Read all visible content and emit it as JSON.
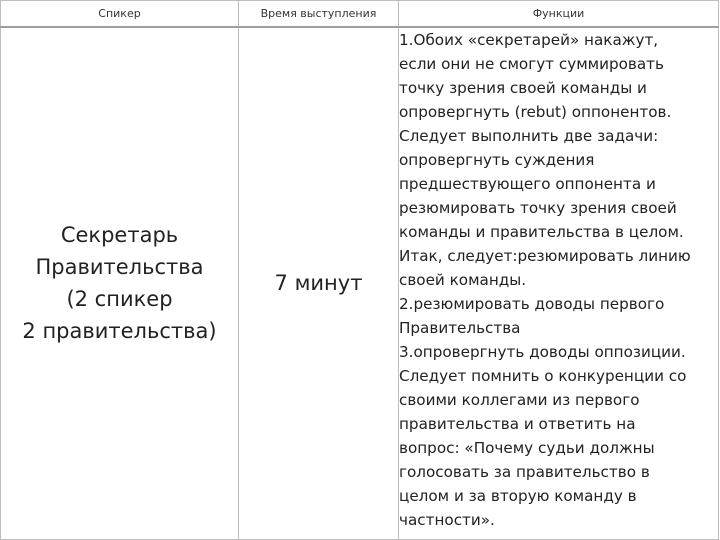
{
  "table": {
    "headers": {
      "speaker": "Спикер",
      "time": "Время выступления",
      "functions": "Функции"
    },
    "row": {
      "speaker_lines": [
        "Секретарь",
        "Правительства",
        "(2 спикер",
        "2 правительства)"
      ],
      "time": "7 минут",
      "function_lines": [
        "1.Обоих «секретарей» накажут,",
        "если они не смогут суммировать",
        "точку зрения своей команды и",
        "опровергнуть (rebut) оппонентов.",
        "Следует выполнить две задачи:",
        "опровергнуть суждения",
        "предшествующего оппонента и",
        "резюмировать точку зрения своей",
        "команды и правительства в целом.",
        "Итак, следует:резюмировать линию",
        "своей команды.",
        "2.резюмировать доводы первого",
        "Правительства",
        "3.опровергнуть доводы оппозиции.",
        "Следует помнить о конкуренции со",
        "своими коллегами из первого",
        "правительства и ответить на",
        "вопрос: «Почему судьи должны",
        "голосовать за правительство в",
        "целом и за вторую команду в",
        "частности»."
      ]
    }
  }
}
